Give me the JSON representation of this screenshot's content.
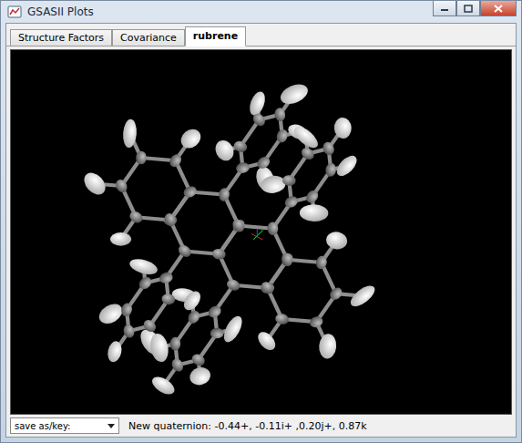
{
  "window": {
    "title": "GSASII Plots"
  },
  "tabs": [
    {
      "label": "Structure Factors",
      "selected": false
    },
    {
      "label": "Covariance",
      "selected": false
    },
    {
      "label": "rubrene",
      "selected": true
    }
  ],
  "status_bar": {
    "dropdown": {
      "value": "save as/key:"
    },
    "message": "New quaternion: -0.44+, -0.11i+ ,0.20j+, 0.87k"
  }
}
